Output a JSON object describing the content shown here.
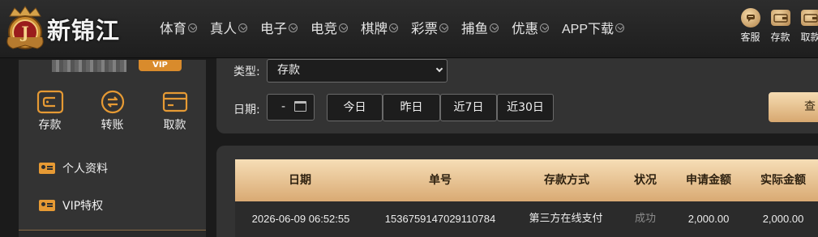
{
  "brand": {
    "name": "新锦江",
    "badge_letter": "J"
  },
  "nav": {
    "items": [
      {
        "label": "体育"
      },
      {
        "label": "真人"
      },
      {
        "label": "电子"
      },
      {
        "label": "电竞"
      },
      {
        "label": "棋牌"
      },
      {
        "label": "彩票"
      },
      {
        "label": "捕鱼"
      },
      {
        "label": "优惠"
      },
      {
        "label": "APP下载"
      }
    ]
  },
  "actions": [
    {
      "label": "客服",
      "icon": "chat-icon"
    },
    {
      "label": "存款",
      "icon": "wallet-icon"
    },
    {
      "label": "取款",
      "icon": "wallet-icon"
    }
  ],
  "sidebar": {
    "vip_tag": "VIP",
    "quick": [
      {
        "label": "存款",
        "icon": "wallet-icon"
      },
      {
        "label": "转账",
        "icon": "transfer-icon"
      },
      {
        "label": "取款",
        "icon": "card-icon"
      }
    ],
    "menu": [
      {
        "label": "个人资料",
        "icon": "profile-card-icon"
      },
      {
        "label": "VIP特权",
        "icon": "vip-card-icon"
      }
    ]
  },
  "filter": {
    "type_label": "类型:",
    "type_value": "存款",
    "date_label": "日期:",
    "date_value": "-",
    "quick_ranges": [
      "今日",
      "昨日",
      "近7日",
      "近30日"
    ],
    "search_label": "查"
  },
  "table": {
    "headers": [
      "日期",
      "单号",
      "存款方式",
      "状况",
      "申请金额",
      "实际金额"
    ],
    "rows": [
      [
        "2026-06-09 06:52:55",
        "1536759147029110784",
        "第三方在线支付",
        "成功",
        "2,000.00",
        "2,000.00"
      ]
    ]
  }
}
